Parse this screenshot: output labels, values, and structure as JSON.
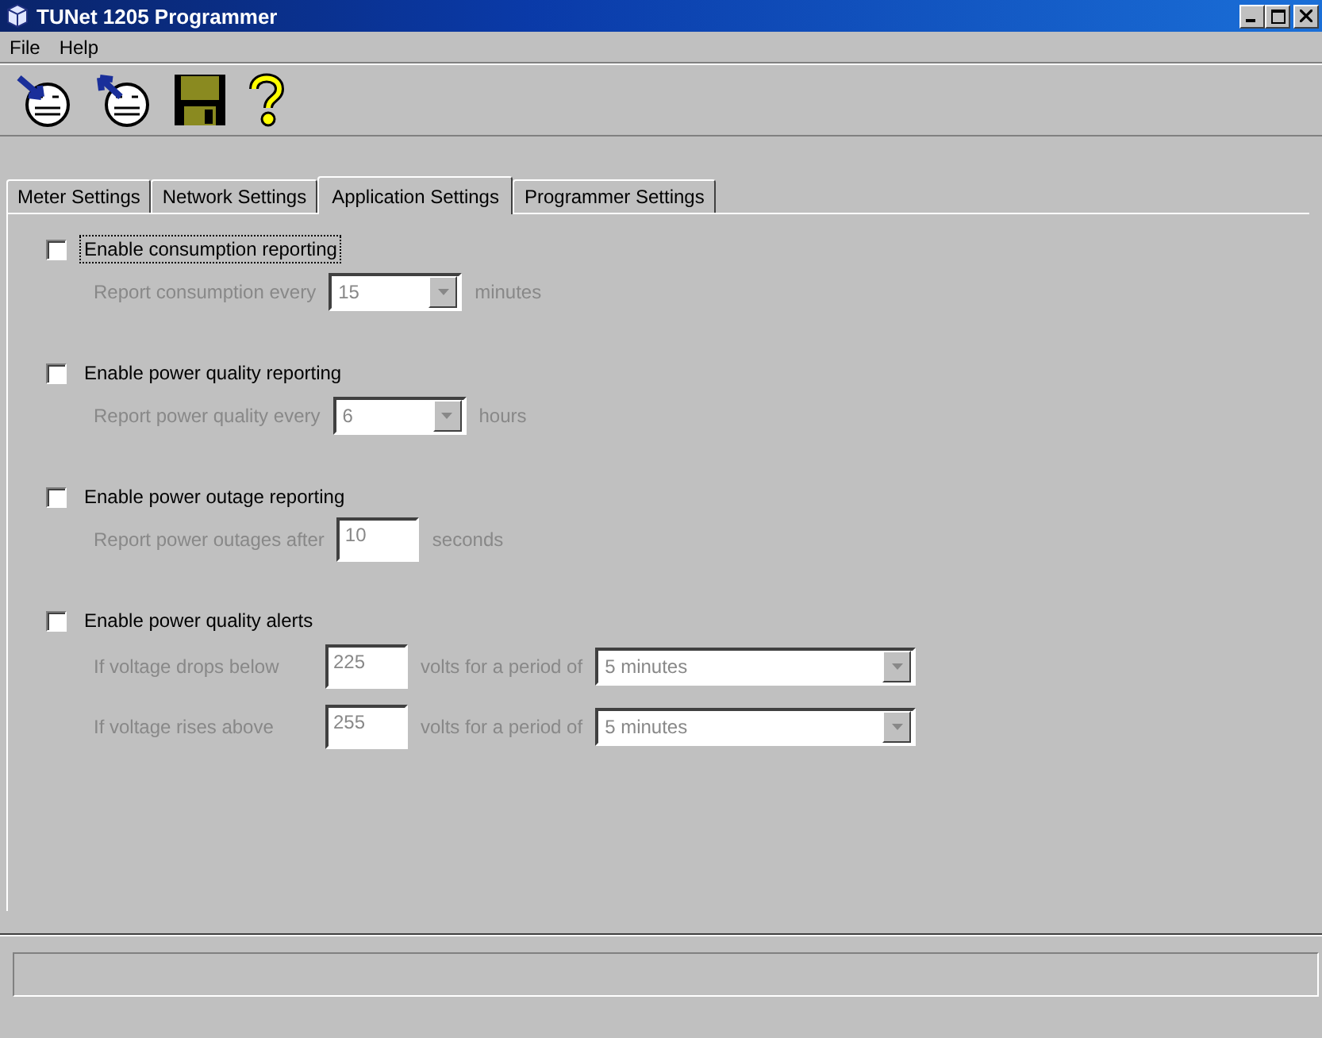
{
  "window": {
    "title": "TUNet 1205 Programmer"
  },
  "menu": [
    {
      "label": "File"
    },
    {
      "label": "Help"
    }
  ],
  "toolbar": [
    {
      "kind": "read"
    },
    {
      "kind": "write"
    },
    {
      "kind": "save"
    },
    {
      "kind": "help"
    }
  ],
  "tabs": [
    {
      "label": "Meter Settings",
      "selected": false
    },
    {
      "label": "Network Settings",
      "selected": false
    },
    {
      "label": "Application Settings",
      "selected": true
    },
    {
      "label": "Programmer Settings",
      "selected": false
    }
  ],
  "sections": [
    {
      "label": "Enable consumption reporting",
      "checked": false,
      "focused": true,
      "rows": [
        {
          "kind": "combo",
          "label": "Report consumption every",
          "value": "15",
          "unit": "minutes"
        }
      ]
    },
    {
      "label": "Enable power quality reporting",
      "checked": false,
      "focused": false,
      "rows": [
        {
          "kind": "combo",
          "label": "Report power quality every",
          "value": "6",
          "unit": "hours"
        }
      ]
    },
    {
      "label": "Enable power outage reporting",
      "checked": false,
      "focused": false,
      "rows": [
        {
          "kind": "text",
          "label": "Report power outages after",
          "value": "10",
          "unit": "seconds"
        }
      ]
    },
    {
      "label": "Enable power quality alerts",
      "checked": false,
      "focused": false,
      "rows": [
        {
          "kind": "threshold",
          "label": "If voltage drops below",
          "value": "225",
          "unit": "volts for a period of",
          "period": "5 minutes"
        },
        {
          "kind": "threshold",
          "label": "If voltage rises above",
          "value": "255",
          "unit": "volts for a period of",
          "period": "5 minutes"
        }
      ]
    }
  ]
}
